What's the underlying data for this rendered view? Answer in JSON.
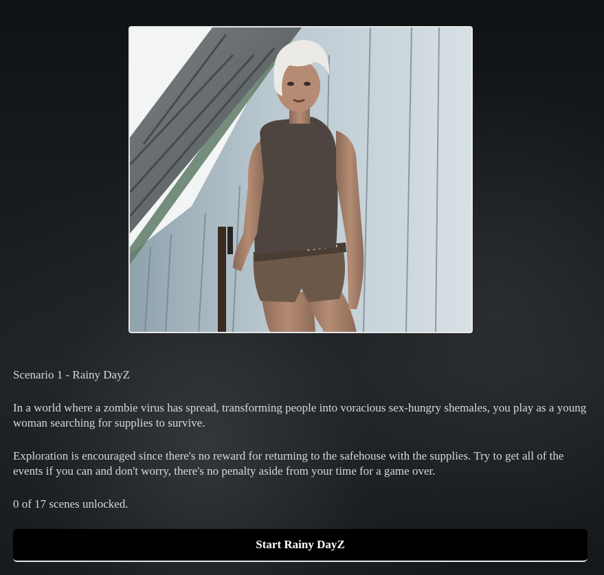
{
  "scenario": {
    "image_alt": "Scenario 1 artwork",
    "title": "Scenario 1 - Rainy DayZ",
    "description_1": "In a world where a zombie virus has spread, transforming people into voracious sex-hungry shemales, you play as a young woman searching for supplies to survive.",
    "description_2": "Exploration is encouraged since there's no reward for returning to the safehouse with the supplies. Try to get all of the events if you can and don't worry, there's no penalty aside from your time for a game over.",
    "scenes_unlocked": "0 of 17 scenes unlocked.",
    "start_label": "Start Rainy DayZ"
  },
  "colors": {
    "background": "#1a1d20",
    "text": "#d8d8d8",
    "button_bg": "#000000",
    "button_text": "#ffffff"
  }
}
